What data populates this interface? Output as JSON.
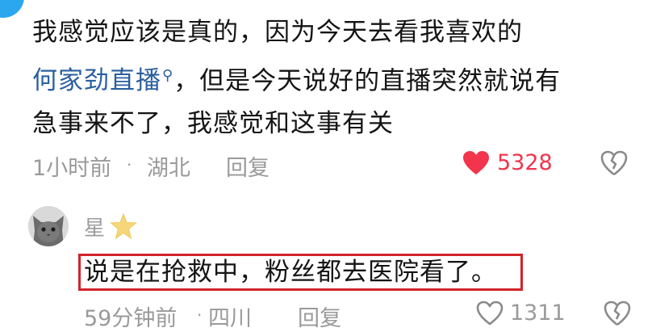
{
  "comment": {
    "text_line1": "我感觉应该是真的，因为今天去看我喜欢的",
    "topic_link": "何家劲直播",
    "text_line2_rest": "，但是今天说好的直播突然就说有",
    "text_line3": "急事来不了，我感觉和这事有关",
    "time": "1小时前",
    "separator": "·",
    "location": "湖北",
    "reply_label": "回复",
    "like_count": "5328"
  },
  "reply": {
    "username": "星",
    "text": "说是在抢救中，粉丝都去医院看了。",
    "time": "59分钟前",
    "separator": "·",
    "location": "四川",
    "reply_label": "回复",
    "like_count": "1311"
  },
  "colors": {
    "link": "#2a5f9e",
    "like_active": "#f2344d",
    "meta_gray": "#9a9a9a",
    "highlight_box": "#d2232a",
    "avatar_blue": "#2aa7ee"
  }
}
